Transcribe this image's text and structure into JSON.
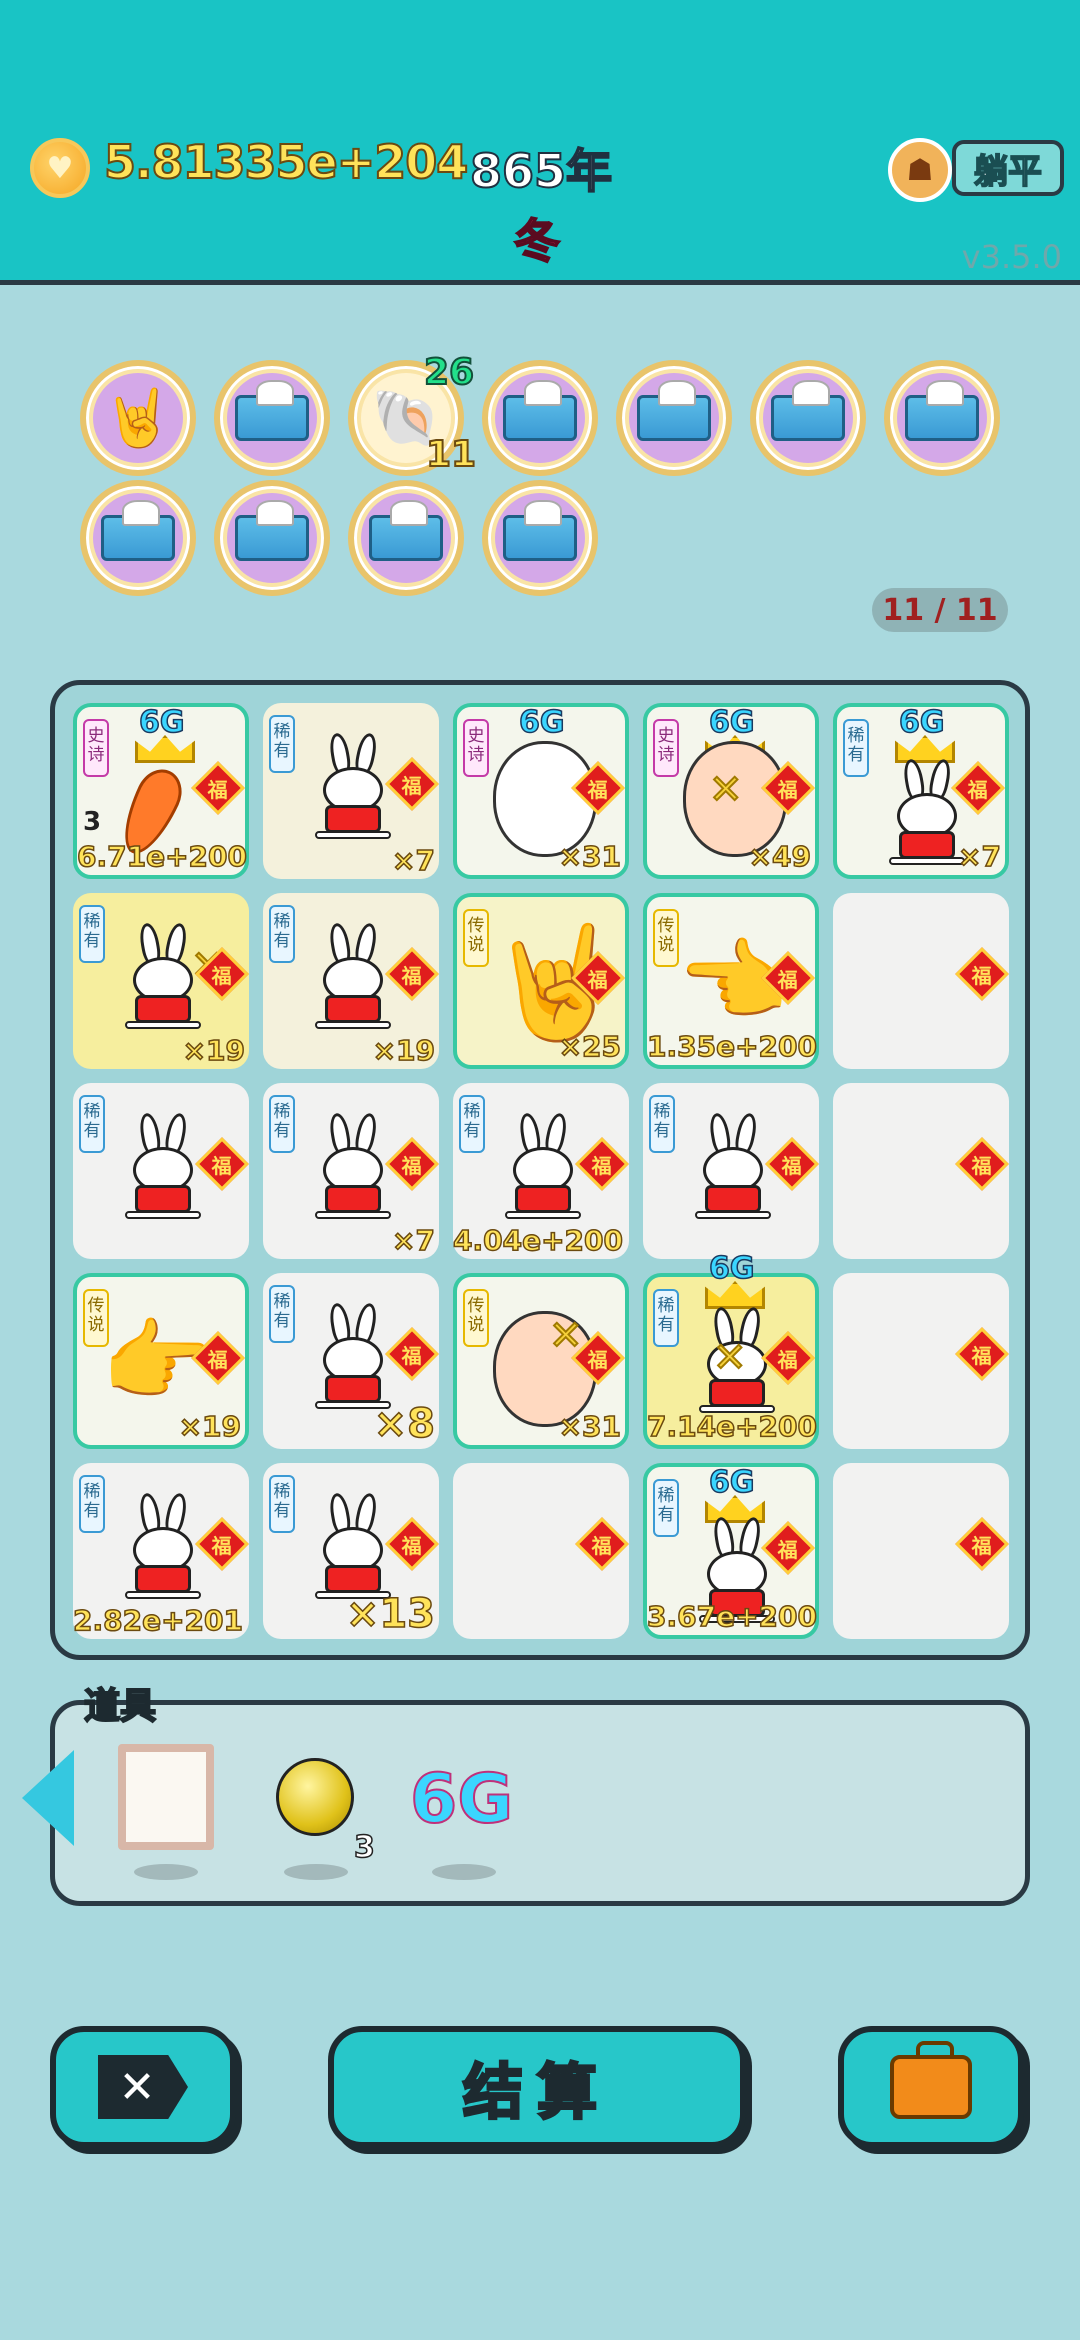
{
  "header": {
    "coins": "5.81335e+204",
    "year": "865年",
    "season": "冬",
    "lie_flat_label": "躺平",
    "version": "v3.5.0"
  },
  "items": {
    "row1": [
      "hand-rock-icon",
      "tissue-box-icon",
      "shell-icon",
      "tissue-box-icon",
      "tissue-box-icon",
      "tissue-box-icon",
      "tissue-box-icon"
    ],
    "row2": [
      "tissue-box-icon",
      "tissue-box-icon",
      "tissue-box-icon",
      "tissue-box-icon"
    ],
    "shell_top_num": "26",
    "shell_bottom_num": "11"
  },
  "counter": "11 / 11",
  "board": {
    "rarity": {
      "rare": "稀有",
      "epic": "史诗",
      "legend": "传说"
    },
    "fu": "福",
    "sixg": "6G",
    "cells": [
      {
        "count": "6.71e+200",
        "side": "3"
      },
      {
        "count": "×7"
      },
      {
        "count": "×31"
      },
      {
        "count": "×49"
      },
      {
        "count": "×7"
      },
      {
        "count": "×19"
      },
      {
        "count": "×19"
      },
      {
        "count": "×25"
      },
      {
        "count": "1.35e+200"
      },
      {
        "count": ""
      },
      {
        "count": ""
      },
      {
        "count": "×7"
      },
      {
        "count": "4.04e+200"
      },
      {
        "count": ""
      },
      {
        "count": ""
      },
      {
        "count": "×19"
      },
      {
        "count": "×8"
      },
      {
        "count": "×31"
      },
      {
        "count": "7.14e+200"
      },
      {
        "count": ""
      },
      {
        "count": "2.82e+201"
      },
      {
        "count": "×13"
      },
      {
        "count": ""
      },
      {
        "count": "3.67e+200"
      },
      {
        "count": ""
      }
    ]
  },
  "tools": {
    "title": "道具",
    "ball_count": "3",
    "sixg": "6G"
  },
  "buttons": {
    "settle": "结算"
  },
  "colors": {
    "header_bg": "#19c4c5",
    "page_bg": "#a9d9de",
    "accent_yellow": "#ffe35a",
    "season_red": "#ff3f6c"
  }
}
